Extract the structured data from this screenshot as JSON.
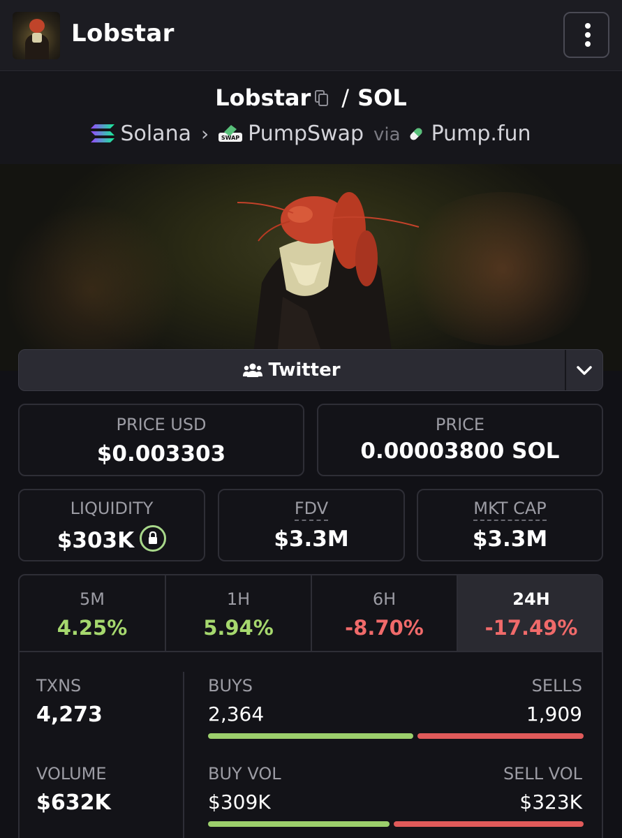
{
  "header": {
    "title": "Lobstar",
    "menu_icon": "more-vertical-icon"
  },
  "pair": {
    "base": "Lobstar",
    "separator": "/",
    "quote": "SOL",
    "chain": "Solana",
    "dex": "PumpSwap",
    "dex_badge": "SWAP",
    "via": "via",
    "launchpad": "Pump.fun"
  },
  "social": {
    "label": "Twitter"
  },
  "prices": {
    "usd_label": "PRICE USD",
    "usd_value": "$0.003303",
    "native_label": "PRICE",
    "native_value": "0.00003800 SOL"
  },
  "metrics": {
    "liquidity_label": "LIQUIDITY",
    "liquidity_value": "$303K",
    "fdv_label": "FDV",
    "fdv_value": "$3.3M",
    "mktcap_label": "MKT CAP",
    "mktcap_value": "$3.3M"
  },
  "periods": [
    {
      "label": "5M",
      "change": "4.25%",
      "trend": "up"
    },
    {
      "label": "1H",
      "change": "5.94%",
      "trend": "up"
    },
    {
      "label": "6H",
      "change": "-8.70%",
      "trend": "down"
    },
    {
      "label": "24H",
      "change": "-17.49%",
      "trend": "down",
      "active": true
    }
  ],
  "stats": {
    "txns_label": "TXNS",
    "txns_value": "4,273",
    "buys_label": "BUYS",
    "buys_value": "2,364",
    "sells_label": "SELLS",
    "sells_value": "1,909",
    "volume_label": "VOLUME",
    "volume_value": "$632K",
    "buy_vol_label": "BUY VOL",
    "buy_vol_value": "$309K",
    "sell_vol_label": "SELL VOL",
    "sell_vol_value": "$323K",
    "buy_tx_share": 0.553,
    "buy_vol_share": 0.489
  },
  "colors": {
    "positive": "#a6d86e",
    "negative": "#f06a6a",
    "background": "#111116"
  }
}
